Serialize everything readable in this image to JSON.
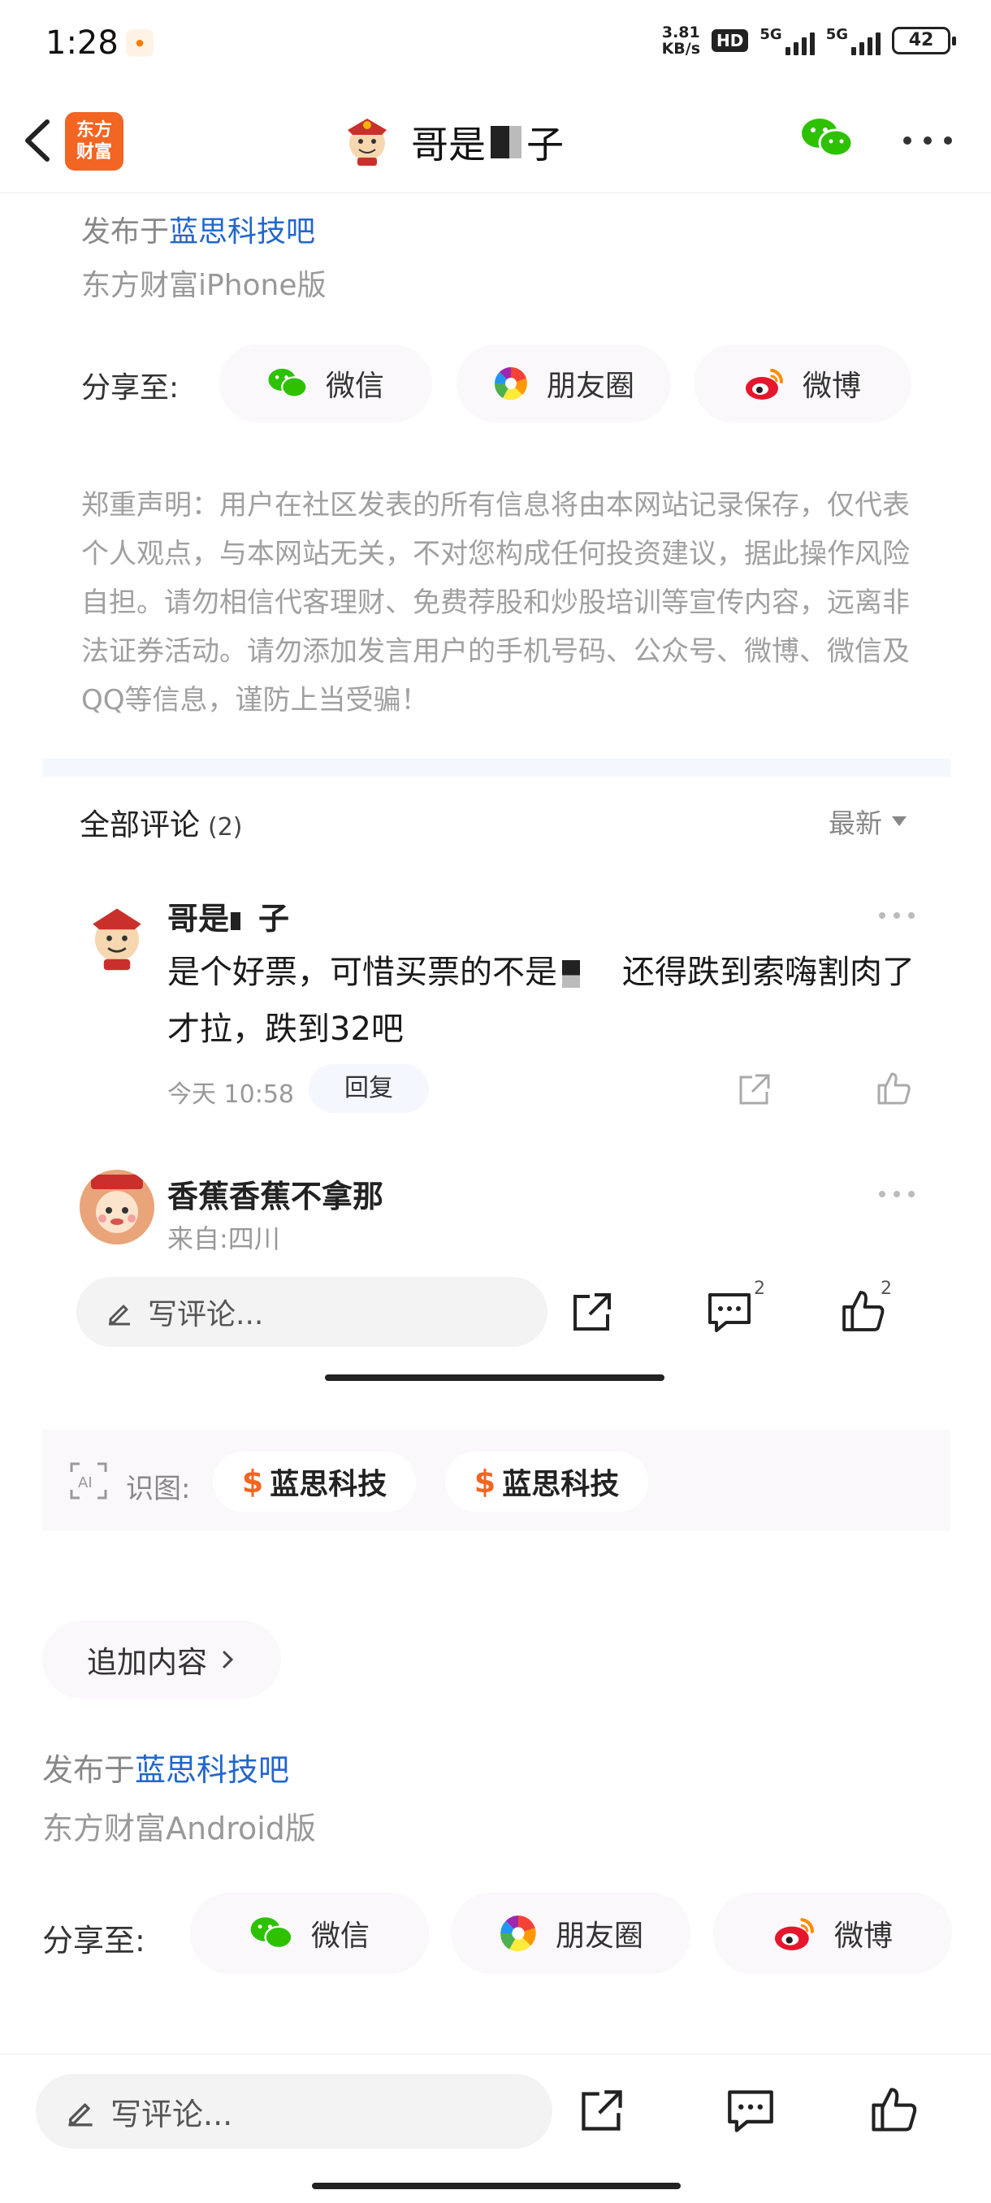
{
  "status_bar": {
    "time": "1:28",
    "net_speed_value": "3.81",
    "net_speed_unit": "KB/s",
    "hd_label": "HD",
    "signal1_label": "5G",
    "signal2_label": "5G",
    "battery": "42"
  },
  "header": {
    "logo_line1": "东方",
    "logo_line2": "财富",
    "title_prefix": "哥是",
    "title_suffix": "子"
  },
  "post_footer": {
    "published_prefix": "发布于",
    "published_link": "蓝思科技吧",
    "client": "东方财富iPhone版"
  },
  "share": {
    "label": "分享至:",
    "wechat": "微信",
    "moments": "朋友圈",
    "weibo": "微博"
  },
  "disclaimer": "郑重声明：用户在社区发表的所有信息将由本网站记录保存，仅代表个人观点，与本网站无关，不对您构成任何投资建议，据此操作风险自担。请勿相信代客理财、免费荐股和炒股培训等宣传内容，远离非法证券活动。请勿添加发言用户的手机号码、公众号、微博、微信及QQ等信息，谨防上当受骗！",
  "comments": {
    "header": "全部评论",
    "count": "(2)",
    "sort": "最新",
    "items": [
      {
        "name_prefix": "哥是",
        "name_suffix": "子",
        "text_part1": "是个好票，可惜买票的不是",
        "text_part2": "还得跌到索嗨割肉了才拉，跌到32吧",
        "time": "今天 10:58",
        "reply": "回复"
      },
      {
        "name": "香蕉香蕉不拿那",
        "location": "来自:四川"
      }
    ]
  },
  "action_bar_1": {
    "placeholder": "写评论...",
    "comment_count": "2",
    "like_count": "2"
  },
  "ai_strip": {
    "label": "识图:",
    "stock1": "蓝思科技",
    "stock2": "蓝思科技",
    "currency_symbol": "$"
  },
  "add_content": "追加内容",
  "post_footer_2": {
    "published_prefix": "发布于",
    "published_link": "蓝思科技吧",
    "client": "东方财富Android版"
  },
  "share_2": {
    "label": "分享至:",
    "wechat": "微信",
    "moments": "朋友圈",
    "weibo": "微博"
  },
  "action_bar_2": {
    "placeholder": "写评论..."
  },
  "colors": {
    "brand_orange": "#f26522",
    "link_blue": "#2266cc",
    "wechat_green": "#2dc100"
  }
}
